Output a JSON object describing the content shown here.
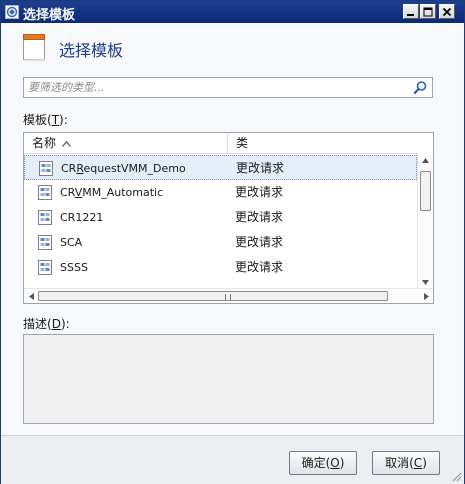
{
  "window": {
    "title": "选择模板"
  },
  "header": {
    "title": "选择模板",
    "icon": "template-icon"
  },
  "search": {
    "placeholder": "要筛选的类型...",
    "value": "",
    "icon": "search-icon"
  },
  "templates": {
    "label_prefix": "模板(",
    "label_key": "T",
    "label_suffix": "):",
    "columns": [
      "名称",
      "类"
    ],
    "rows": [
      {
        "name_pre": "CR",
        "name_key": "R",
        "name_post": "equestVMM_Demo",
        "type": "更改请求",
        "selected": true
      },
      {
        "name_pre": "CR",
        "name_key": "V",
        "name_post": "MM_Automatic",
        "type": "更改请求",
        "selected": false
      },
      {
        "name_pre": "CR1221",
        "name_key": "",
        "name_post": "",
        "type": "更改请求",
        "selected": false
      },
      {
        "name_pre": "SCA",
        "name_key": "",
        "name_post": "",
        "type": "更改请求",
        "selected": false
      },
      {
        "name_pre": "SSSS",
        "name_key": "",
        "name_post": "",
        "type": "更改请求",
        "selected": false
      }
    ]
  },
  "description": {
    "label_prefix": "描述(",
    "label_key": "D",
    "label_suffix": "):",
    "value": ""
  },
  "buttons": {
    "ok_prefix": "确定(",
    "ok_key": "O",
    "ok_suffix": ")",
    "cancel_prefix": "取消(",
    "cancel_key": "C",
    "cancel_suffix": ")"
  },
  "colors": {
    "titlebar": "#0a2a78",
    "header_title": "#1e3c8c",
    "selection": "#e4eef9"
  }
}
